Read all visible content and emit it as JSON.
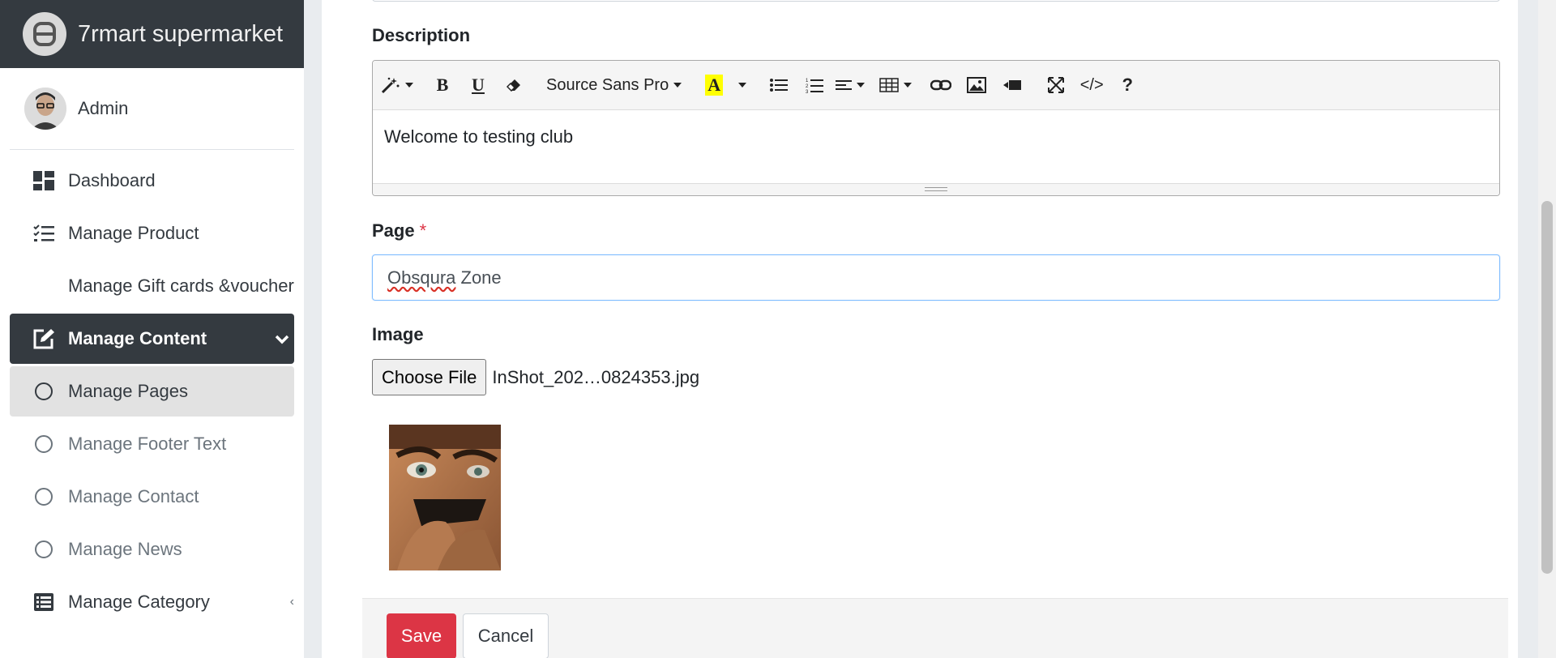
{
  "brand": {
    "name": "7rmart supermarket",
    "logo_icon": "brand-logo-icon"
  },
  "user": {
    "name": "Admin"
  },
  "sidebar": {
    "items": [
      {
        "label": "Dashboard",
        "icon": "dashboard-grid-icon"
      },
      {
        "label": "Manage Product",
        "icon": "checklist-icon"
      },
      {
        "label": "Manage Gift cards &voucher",
        "icon": ""
      },
      {
        "label": "Manage Content",
        "icon": "edit-square-icon",
        "state": "open"
      },
      {
        "label": "Manage Pages",
        "icon": "circle-icon",
        "state": "current"
      },
      {
        "label": "Manage Footer Text",
        "icon": "circle-icon"
      },
      {
        "label": "Manage Contact",
        "icon": "circle-icon"
      },
      {
        "label": "Manage News",
        "icon": "circle-icon"
      },
      {
        "label": "Manage Category",
        "icon": "list-table-icon"
      }
    ]
  },
  "form": {
    "description_label": "Description",
    "editor": {
      "font_name": "Source Sans Pro",
      "content": "Welcome to testing club"
    },
    "page_label": "Page",
    "page_required_mark": "*",
    "page_value": "Obsqura Zone",
    "page_value_parts": [
      "Obsqura",
      " Zone"
    ],
    "image_label": "Image",
    "file_button_label": "Choose File",
    "file_name": "InShot_202…0824353.jpg",
    "save_label": "Save",
    "cancel_label": "Cancel"
  },
  "colors": {
    "sidebar_header": "#343a40",
    "active_nav": "#343a40",
    "save_button": "#dc3545",
    "required_mark": "#dc3545",
    "focus_border": "#80bdff"
  }
}
